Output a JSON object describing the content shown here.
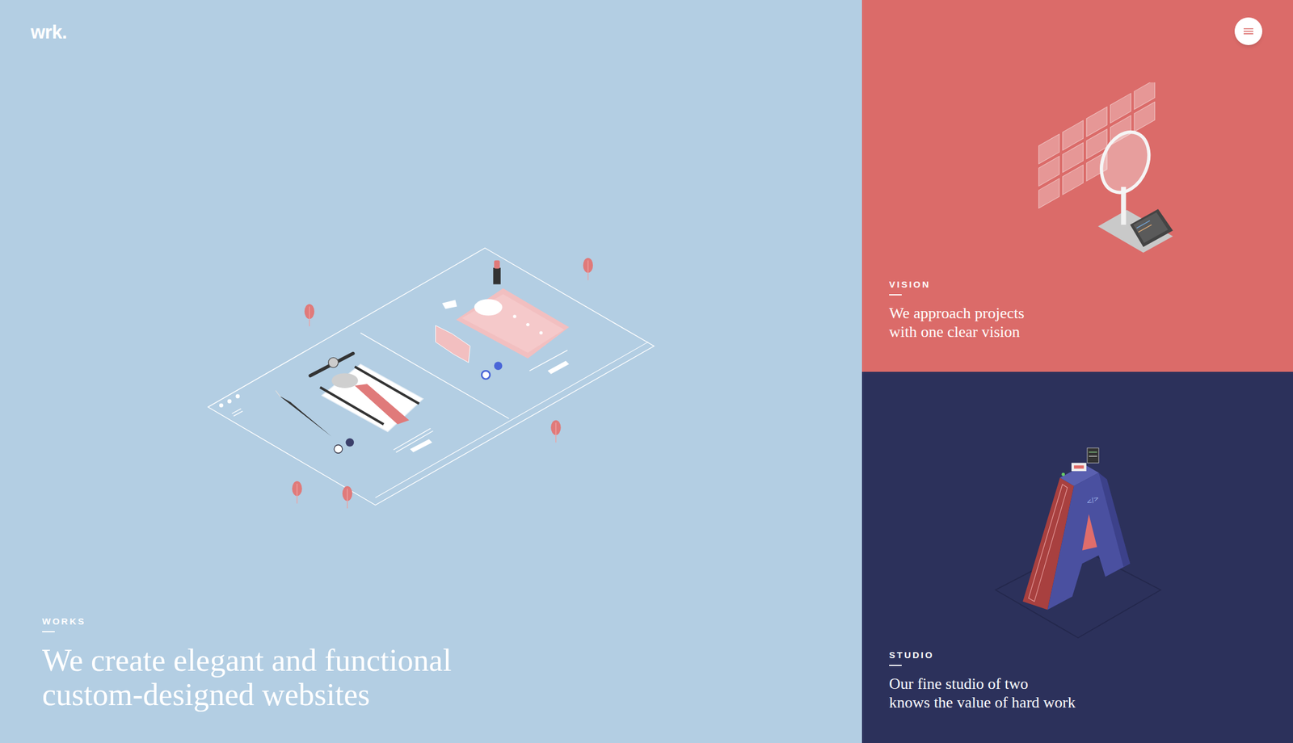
{
  "logo": "wrk.",
  "works": {
    "label": "WORKS",
    "lines": [
      "We create elegant and functional",
      "custom-designed websites"
    ]
  },
  "vision": {
    "label": "VISION",
    "lines": [
      "We approach projects",
      "with one clear vision"
    ]
  },
  "studio": {
    "label": "STUDIO",
    "lines": [
      "Our fine studio of two",
      "knows the value of hard work"
    ],
    "illustration_label": "</>"
  }
}
